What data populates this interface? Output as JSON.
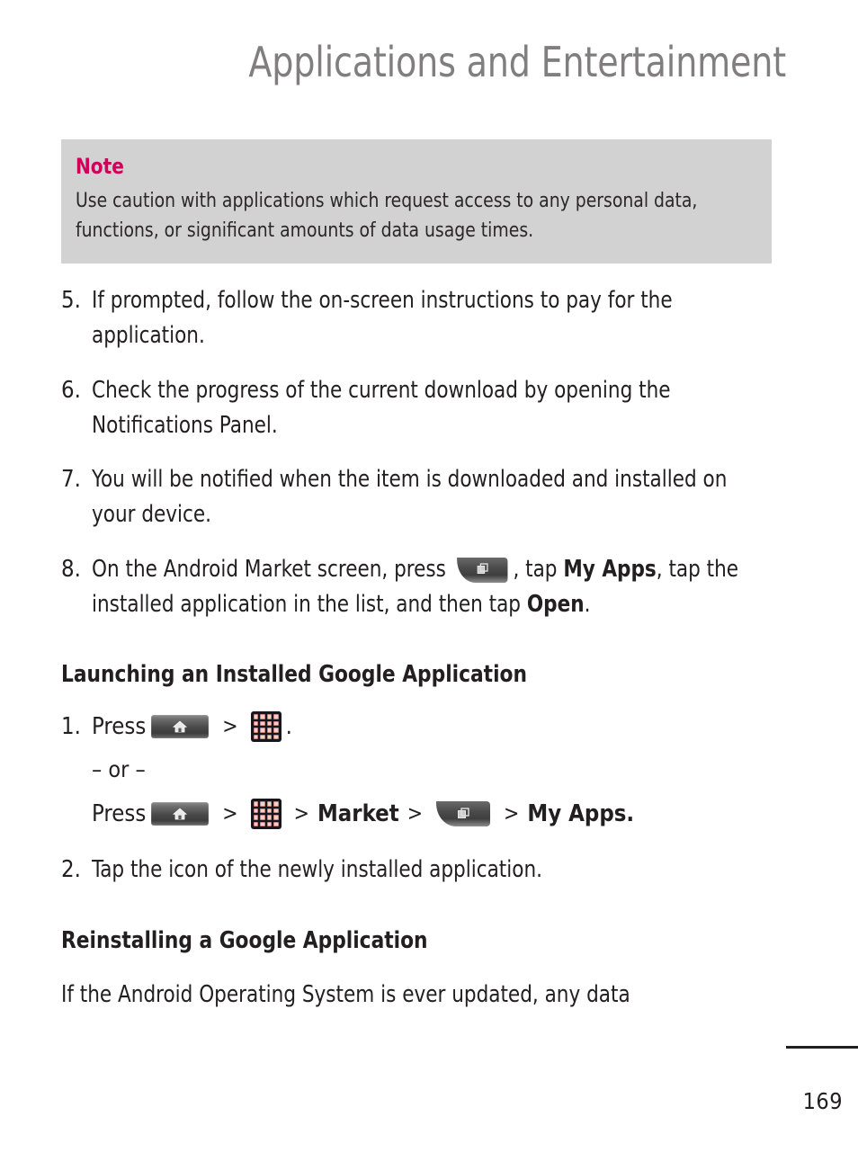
{
  "header": {
    "running_title": "Applications and Entertainment"
  },
  "note": {
    "title": "Note",
    "body": "Use caution with applications which request access to any personal data, functions, or significant amounts of data usage times.",
    "background_color": "#d2d2d2",
    "title_color": "#d1005a"
  },
  "steps": [
    {
      "number": "5.",
      "text": "If prompted, follow the on-screen instructions to pay for the application."
    },
    {
      "number": "6.",
      "text": "Check the progress of the current download by opening the Notifications Panel."
    },
    {
      "number": "7.",
      "text": "You will be notified when the item is downloaded and installed on your device."
    }
  ],
  "step8": {
    "number": "8.",
    "part1": "On the Android Market screen, press",
    "icon": "menu-key-icon",
    "part2": ", tap ",
    "bold1": "My Apps",
    "part3": ", tap the installed application in the list, and then tap ",
    "bold2": "Open",
    "part4": "."
  },
  "sections": [
    {
      "heading": "Launching an Installed Google Application"
    },
    {
      "heading": "Reinstalling a Google Application"
    }
  ],
  "launch": {
    "step1_number": "1.",
    "press_label": "Press",
    "home_icon": "home-key-icon",
    "separator": ">",
    "apps_icon": "apps-grid-icon",
    "period": ".",
    "or_label": "– or –",
    "press_label_2": "Press",
    "market_label": "Market",
    "menu_icon": "menu-key-icon",
    "my_apps_label": "My Apps.",
    "step2_number": "2.",
    "step2_text": "Tap the icon of the newly installed application."
  },
  "reinstall": {
    "body": "If the Android Operating System is ever updated, any data"
  },
  "footer": {
    "page_number": "169"
  }
}
